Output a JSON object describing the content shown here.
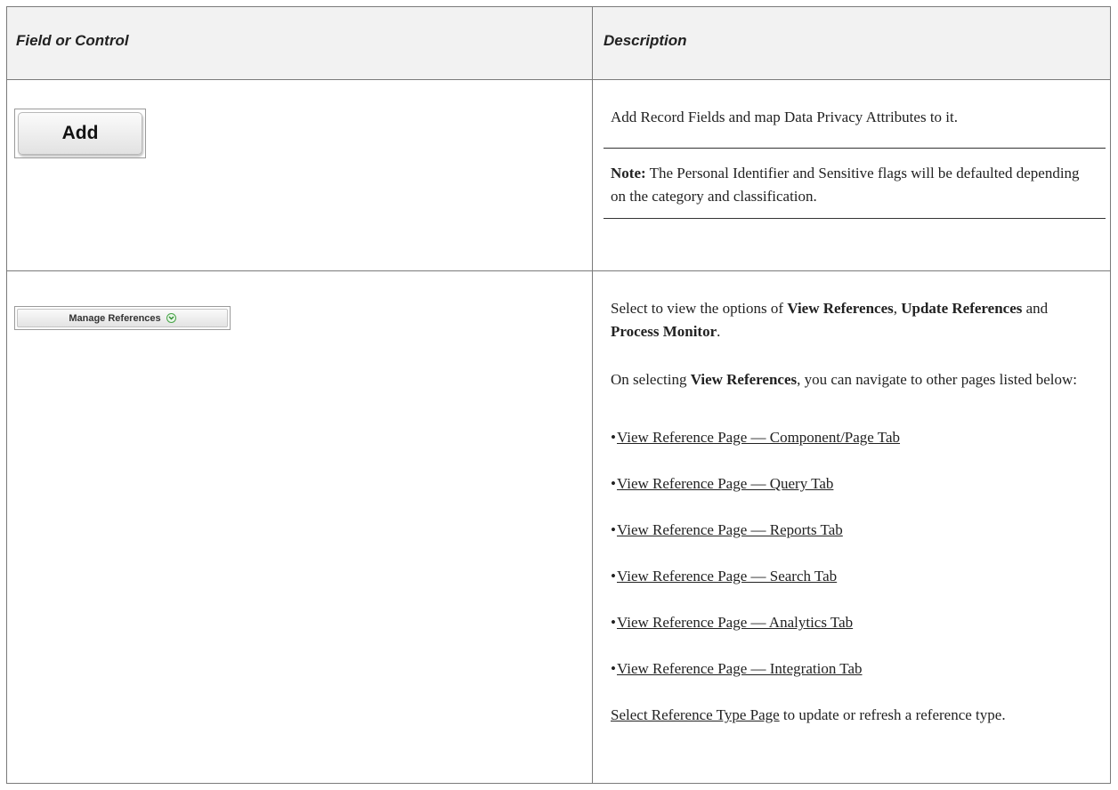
{
  "table": {
    "headers": {
      "field_or_control": "Field or Control",
      "description": "Description"
    },
    "rows": [
      {
        "control_label": "Add",
        "description": "Add Record Fields and map Data Privacy Attributes to it.",
        "note_label": "Note:",
        "note_text": " The Personal Identifier and Sensitive flags will be defaulted depending on the category and classification."
      },
      {
        "control_label": "Manage References",
        "control_icon": "chevron-down-circle-icon",
        "desc_prefix": "Select to view the options of ",
        "opt1": "View References",
        "sep1": ", ",
        "opt2": "Update References",
        "sep2": " and ",
        "opt3": "Process Monitor",
        "sep3": ".",
        "nav_prefix": "On selecting ",
        "nav_bold": "View References",
        "nav_suffix": ", you can navigate to other pages listed below:",
        "bullet_char": "•",
        "links": [
          "View Reference Page — Component/Page Tab",
          "View Reference Page — Query Tab",
          "View Reference Page — Reports Tab",
          "View Reference Page — Search Tab",
          "View Reference Page — Analytics Tab",
          "View Reference Page — Integration Tab"
        ],
        "select_link": "Select Reference Type Page",
        "select_suffix": " to update or refresh a reference type."
      }
    ]
  },
  "colors": {
    "header_bg": "#f2f2f2",
    "border": "#7a7a7a",
    "text": "#222222",
    "icon_green": "#47a447"
  }
}
